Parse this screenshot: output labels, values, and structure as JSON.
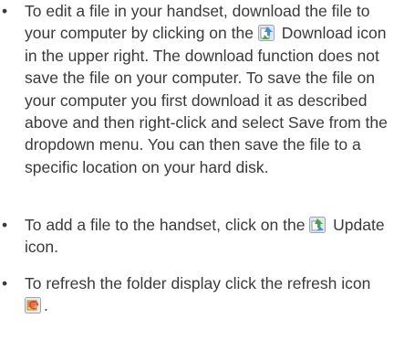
{
  "items": [
    {
      "bullet": "•",
      "before": "To edit a file in your handset, download the file to your computer by clicking on the",
      "icon": "download-icon",
      "after": "Download icon in the upper right. The download function does not save the file on your computer. To save the file on your computer you first download it as described above and then right-click and select Save from the dropdown menu. You can then save the file to a specific location on your hard disk."
    },
    {
      "bullet": "•",
      "before": "To add a file to the handset,  click on the",
      "icon": "update-icon",
      "after": "Update icon."
    },
    {
      "bullet": "•",
      "before": "To refresh the folder display click the refresh icon",
      "icon": "refresh-icon",
      "after": "."
    }
  ]
}
